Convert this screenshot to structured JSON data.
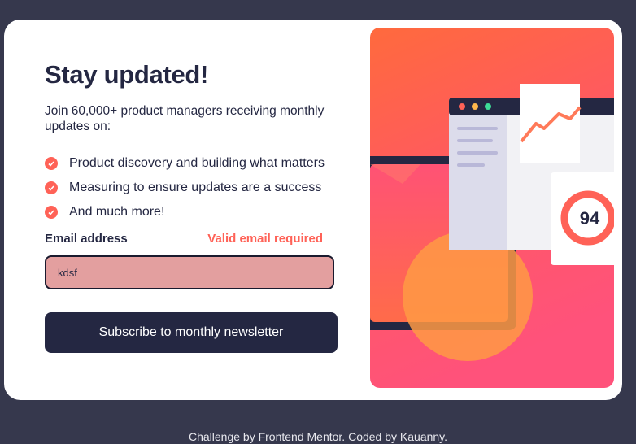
{
  "card": {
    "title": "Stay updated!",
    "intro": "Join 60,000+ product managers receiving monthly updates on:",
    "features": [
      "Product discovery and building what matters",
      "Measuring to ensure updates are a success",
      "And much more!"
    ]
  },
  "form": {
    "email_label": "Email address",
    "error_message": "Valid email required",
    "email_value": "kdsf",
    "submit_label": "Subscribe to monthly newsletter"
  },
  "illustration": {
    "score": "94"
  },
  "footer": {
    "text": "Challenge by Frontend Mentor. Coded by Kauanny."
  },
  "colors": {
    "background": "#36384d",
    "dark_navy": "#242742",
    "tomato": "#ff6257",
    "input_error_fill": "#e39f9f"
  },
  "icons": [
    "check-icon"
  ]
}
